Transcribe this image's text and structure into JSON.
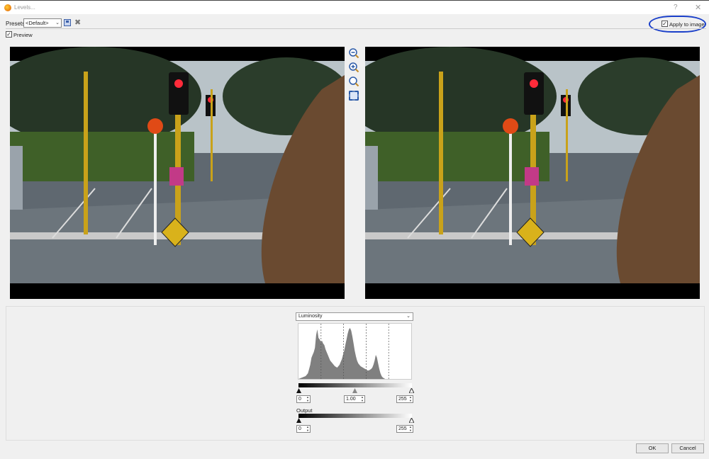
{
  "window": {
    "title": "Levels...",
    "help": "?",
    "close": "✕"
  },
  "toolbar": {
    "presets_label": "Presets:",
    "presets_value": "<Default>",
    "save_icon": "save-icon",
    "delete_icon": "delete-icon"
  },
  "apply": {
    "label": "Apply to image",
    "checked": true,
    "highlight_color": "#1a3fc9"
  },
  "preview": {
    "label": "Preview",
    "checked": true
  },
  "channel": {
    "value": "Luminosity"
  },
  "input": {
    "black": "0",
    "gamma": "1.00",
    "white": "255"
  },
  "output": {
    "label": "Output",
    "black": "0",
    "white": "255"
  },
  "buttons": {
    "ok": "OK",
    "cancel": "Cancel"
  },
  "tools": [
    "zoom-out-icon",
    "zoom-in-icon",
    "zoom-actual-icon",
    "fit-to-window-icon"
  ],
  "histogram": [
    4,
    6,
    8,
    14,
    20,
    30,
    34,
    38,
    44,
    62,
    70,
    58,
    56,
    52,
    54,
    50,
    48,
    42,
    38,
    34,
    30,
    26,
    24,
    22,
    20,
    18,
    17,
    16,
    18,
    20,
    24,
    28,
    34,
    40,
    48,
    56,
    64,
    70,
    72,
    68,
    60,
    50,
    40,
    32,
    26,
    22,
    20,
    18,
    17,
    16,
    15,
    14,
    13,
    12,
    12,
    13,
    14,
    16,
    20,
    26,
    34,
    30,
    22,
    14,
    8,
    4,
    2,
    1,
    0,
    0,
    0,
    0,
    0,
    0,
    0,
    0,
    0,
    0,
    0,
    0
  ]
}
